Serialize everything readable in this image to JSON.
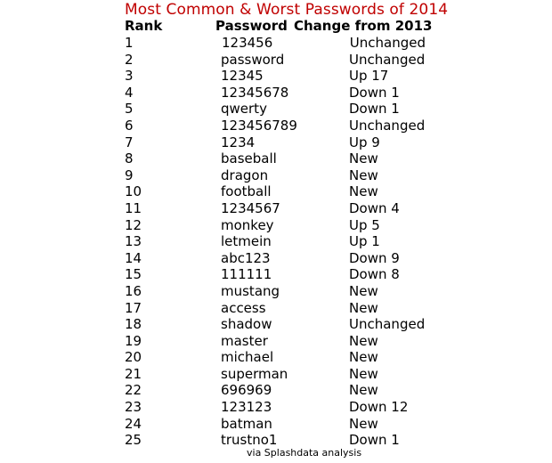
{
  "title": "Most Common & Worst Passwords of 2014",
  "columns": {
    "rank": "Rank",
    "password": "Password",
    "change": "Change from 2013"
  },
  "rows": [
    {
      "rank": "1",
      "password": "123456",
      "change": "Unchanged"
    },
    {
      "rank": "2",
      "password": "password",
      "change": "Unchanged"
    },
    {
      "rank": "3",
      "password": "12345",
      "change": "Up 17"
    },
    {
      "rank": "4",
      "password": "12345678",
      "change": "Down 1"
    },
    {
      "rank": "5",
      "password": "qwerty",
      "change": "Down 1"
    },
    {
      "rank": "6",
      "password": "123456789",
      "change": "Unchanged"
    },
    {
      "rank": "7",
      "password": "1234",
      "change": "Up 9"
    },
    {
      "rank": "8",
      "password": "baseball",
      "change": "New"
    },
    {
      "rank": "9",
      "password": "dragon",
      "change": "New"
    },
    {
      "rank": "10",
      "password": "football",
      "change": "New"
    },
    {
      "rank": "11",
      "password": "1234567",
      "change": "Down 4"
    },
    {
      "rank": "12",
      "password": "monkey",
      "change": "Up 5"
    },
    {
      "rank": "13",
      "password": "letmein",
      "change": "Up 1"
    },
    {
      "rank": "14",
      "password": "abc123",
      "change": "Down 9"
    },
    {
      "rank": "15",
      "password": "111111",
      "change": "Down 8"
    },
    {
      "rank": "16",
      "password": "mustang",
      "change": "New"
    },
    {
      "rank": "17",
      "password": "access",
      "change": "New"
    },
    {
      "rank": "18",
      "password": "shadow",
      "change": "Unchanged"
    },
    {
      "rank": "19",
      "password": "master",
      "change": "New"
    },
    {
      "rank": "20",
      "password": "michael",
      "change": "New"
    },
    {
      "rank": "21",
      "password": "superman",
      "change": "New"
    },
    {
      "rank": "22",
      "password": "696969",
      "change": "New"
    },
    {
      "rank": "23",
      "password": "123123",
      "change": "Down 12"
    },
    {
      "rank": "24",
      "password": "batman",
      "change": "New"
    },
    {
      "rank": "25",
      "password": "trustno1",
      "change": "Down 1"
    }
  ],
  "source": "via Splashdata analysis",
  "colors": {
    "title": "#c00000",
    "text": "#000000",
    "background": "#ffffff"
  }
}
